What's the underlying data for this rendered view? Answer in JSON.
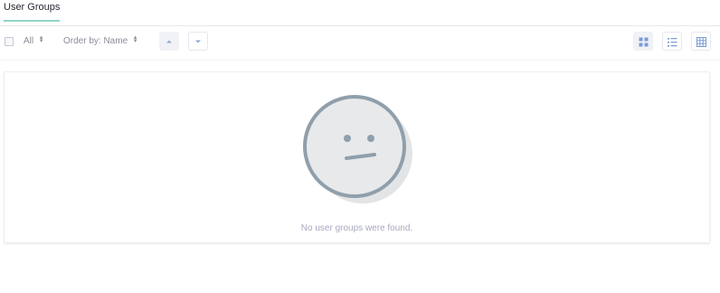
{
  "tabs": [
    {
      "label": "User Groups",
      "active": true
    }
  ],
  "toolbar": {
    "filter_label": "All",
    "order_label": "Order by: Name",
    "sort_asc_icon": "caret-up-icon",
    "sort_desc_icon": "caret-down-icon",
    "view_modes": [
      "cards-view-icon",
      "list-view-icon",
      "table-view-icon"
    ],
    "active_view": "cards-view-icon"
  },
  "empty_state": {
    "icon": "neutral-face-icon",
    "message": "No user groups were found."
  },
  "colors": {
    "accent": "#8fd3c8",
    "face_stroke": "#8f9fab",
    "face_fill": "#e8e9eb",
    "muted_text": "#a7a9bc"
  }
}
